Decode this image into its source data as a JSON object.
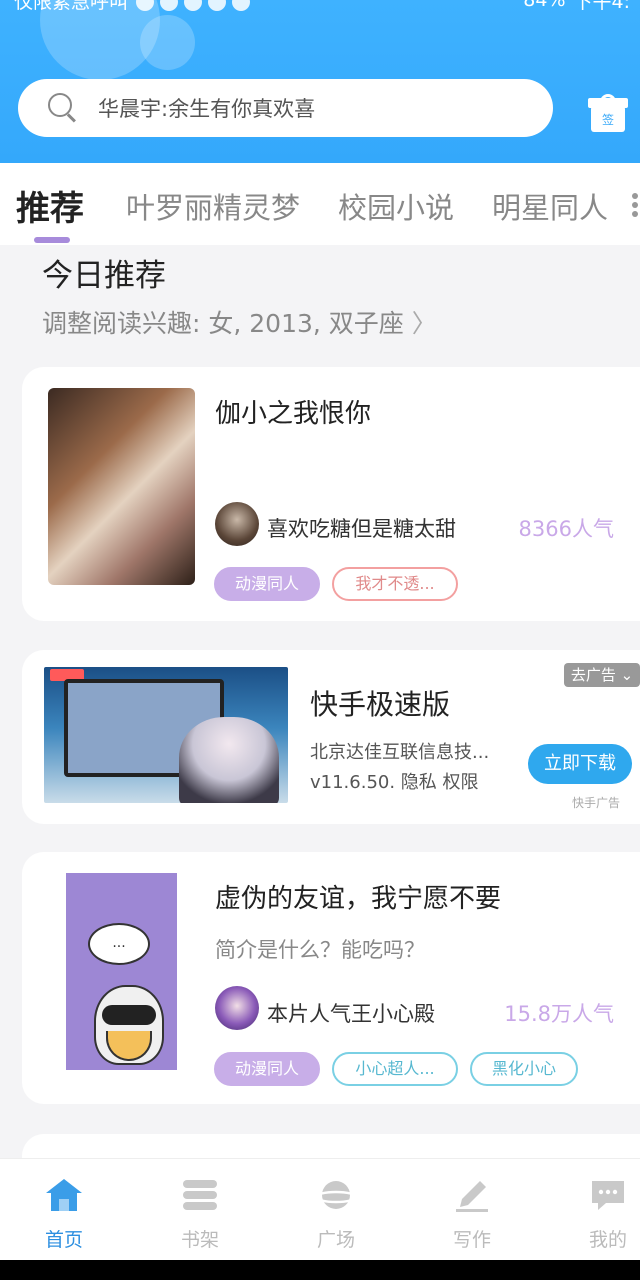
{
  "status_bar": {
    "left_text": "仅限紧急呼叫",
    "battery": "84%",
    "time": "下午4:"
  },
  "search": {
    "placeholder": "华晨宇:余生有你真欢喜"
  },
  "gift": {
    "badge": "签"
  },
  "tabs": [
    {
      "label": "推荐",
      "active": true
    },
    {
      "label": "叶罗丽精灵梦"
    },
    {
      "label": "校园小说"
    },
    {
      "label": "明星同人"
    }
  ],
  "section": {
    "title": "今日推荐",
    "subtitle": "调整阅读兴趣: 女, 2013, 双子座"
  },
  "books": [
    {
      "title": "伽小之我恨你",
      "author": "喜欢吃糖但是糖太甜",
      "popularity": "8366人气",
      "tags": [
        "动漫同人",
        "我才不透..."
      ]
    },
    {
      "title": "虚伪的友谊，我宁愿不要",
      "description": "简介是什么？能吃吗？",
      "author": "本片人气王小心殿",
      "popularity": "15.8万人气",
      "tags": [
        "动漫同人",
        "小心超人...",
        "黑化小心"
      ],
      "cover_text": "..."
    }
  ],
  "ad": {
    "title": "快手极速版",
    "company": "北京达佳互联信息技...",
    "version": "v11.6.50.  隐私  权限",
    "close_label": "去广告",
    "download_label": "立即下载",
    "source": "快手广告"
  },
  "bottom_nav": [
    {
      "label": "首页",
      "icon": "home-icon",
      "active": true
    },
    {
      "label": "书架",
      "icon": "bookshelf-icon"
    },
    {
      "label": "广场",
      "icon": "planet-icon"
    },
    {
      "label": "写作",
      "icon": "pen-icon"
    },
    {
      "label": "我的",
      "icon": "chat-icon"
    }
  ],
  "colors": {
    "header": "#3fb2ff",
    "accent_purple": "#c8aee8",
    "download_blue": "#2fa8ee",
    "nav_active": "#2d8fe0"
  }
}
